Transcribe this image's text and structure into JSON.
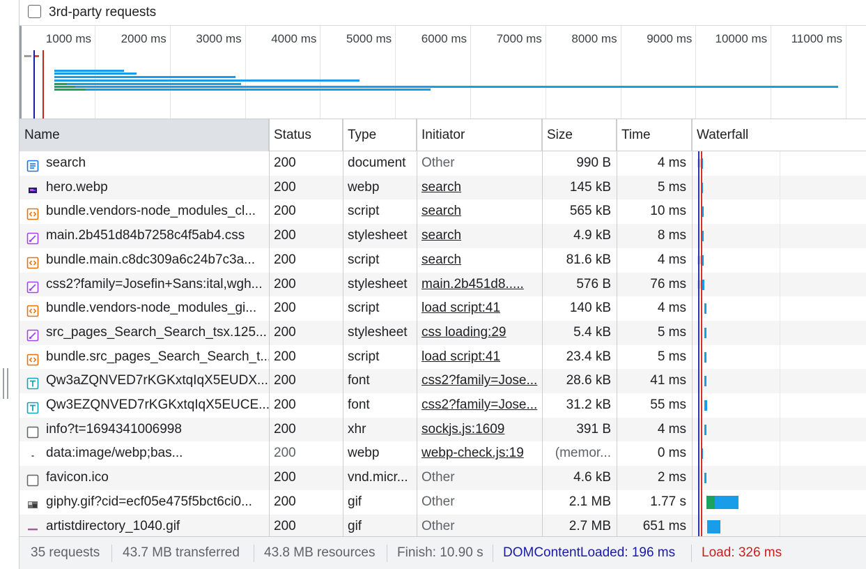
{
  "filter": {
    "third_party_label": "3rd-party requests"
  },
  "overview": {
    "ticks": [
      "1000 ms",
      "2000 ms",
      "3000 ms",
      "4000 ms",
      "5000 ms",
      "6000 ms",
      "7000 ms",
      "8000 ms",
      "9000 ms",
      "10000 ms",
      "11000 ms"
    ]
  },
  "columns": {
    "name": "Name",
    "status": "Status",
    "type": "Type",
    "initiator": "Initiator",
    "size": "Size",
    "time": "Time",
    "waterfall": "Waterfall"
  },
  "rows": [
    {
      "name": "search",
      "icon": "document-icon",
      "status": "200",
      "type": "document",
      "initiator": "Other",
      "initiator_link": false,
      "size": "990 B",
      "time": "4 ms"
    },
    {
      "name": "hero.webp",
      "icon": "image-icon",
      "status": "200",
      "type": "webp",
      "initiator": "search",
      "initiator_link": true,
      "size": "145 kB",
      "time": "5 ms"
    },
    {
      "name": "bundle.vendors-node_modules_cl...",
      "icon": "script-icon",
      "status": "200",
      "type": "script",
      "initiator": "search",
      "initiator_link": true,
      "size": "565 kB",
      "time": "10 ms"
    },
    {
      "name": "main.2b451d84b7258c4f5ab4.css",
      "icon": "stylesheet-icon",
      "status": "200",
      "type": "stylesheet",
      "initiator": "search",
      "initiator_link": true,
      "size": "4.9 kB",
      "time": "8 ms"
    },
    {
      "name": "bundle.main.c8dc309a6c24b7c3a...",
      "icon": "script-icon",
      "status": "200",
      "type": "script",
      "initiator": "search",
      "initiator_link": true,
      "size": "81.6 kB",
      "time": "4 ms"
    },
    {
      "name": "css2?family=Josefin+Sans:ital,wgh...",
      "icon": "stylesheet-icon",
      "status": "200",
      "type": "stylesheet",
      "initiator": "main.2b451d8.....",
      "initiator_link": true,
      "size": "576 B",
      "time": "76 ms"
    },
    {
      "name": "bundle.vendors-node_modules_gi...",
      "icon": "script-icon",
      "status": "200",
      "type": "script",
      "initiator": "load script:41",
      "initiator_link": true,
      "size": "140 kB",
      "time": "4 ms"
    },
    {
      "name": "src_pages_Search_Search_tsx.125...",
      "icon": "stylesheet-icon",
      "status": "200",
      "type": "stylesheet",
      "initiator": "css loading:29",
      "initiator_link": true,
      "size": "5.4 kB",
      "time": "5 ms"
    },
    {
      "name": "bundle.src_pages_Search_Search_t...",
      "icon": "script-icon",
      "status": "200",
      "type": "script",
      "initiator": "load script:41",
      "initiator_link": true,
      "size": "23.4 kB",
      "time": "5 ms"
    },
    {
      "name": "Qw3aZQNVED7rKGKxtqIqX5EUDX...",
      "icon": "font-icon",
      "status": "200",
      "type": "font",
      "initiator": "css2?family=Jose...",
      "initiator_link": true,
      "size": "28.6 kB",
      "time": "41 ms"
    },
    {
      "name": "Qw3EZQNVED7rKGKxtqIqX5EUCE...",
      "icon": "font-icon",
      "status": "200",
      "type": "font",
      "initiator": "css2?family=Jose...",
      "initiator_link": true,
      "size": "31.2 kB",
      "time": "55 ms"
    },
    {
      "name": "info?t=1694341006998",
      "icon": "xhr-icon",
      "status": "200",
      "type": "xhr",
      "initiator": "sockjs.js:1609",
      "initiator_link": true,
      "size": "391 B",
      "time": "4 ms"
    },
    {
      "name": "data:image/webp;bas...",
      "icon": "data-image-icon",
      "status": "200",
      "type": "webp",
      "initiator": "webp-check.js:19",
      "initiator_link": true,
      "size": "(memor...",
      "time": "0 ms",
      "muted_status": true,
      "muted_size": true
    },
    {
      "name": "favicon.ico",
      "icon": "favicon-icon",
      "status": "200",
      "type": "vnd.micr...",
      "initiator": "Other",
      "initiator_link": false,
      "size": "4.6 kB",
      "time": "2 ms"
    },
    {
      "name": "giphy.gif?cid=ecf05e475f5bct6ci0...",
      "icon": "gif-icon",
      "status": "200",
      "type": "gif",
      "initiator": "Other",
      "initiator_link": false,
      "size": "2.1 MB",
      "time": "1.77 s"
    },
    {
      "name": "artistdirectory_1040.gif",
      "icon": "gif-line-icon",
      "status": "200",
      "type": "gif",
      "initiator": "Other",
      "initiator_link": false,
      "size": "2.7 MB",
      "time": "651 ms"
    }
  ],
  "status_bar": {
    "requests": "35 requests",
    "transferred": "43.7 MB transferred",
    "resources": "43.8 MB resources",
    "finish": "Finish: 10.90 s",
    "dom_content_loaded": "DOMContentLoaded: 196 ms",
    "load": "Load: 326 ms"
  },
  "colors": {
    "waiting": "#1aa260",
    "download": "#1a9de8",
    "dom_content_loaded": "#1a1aa6",
    "load": "#c5221f"
  }
}
